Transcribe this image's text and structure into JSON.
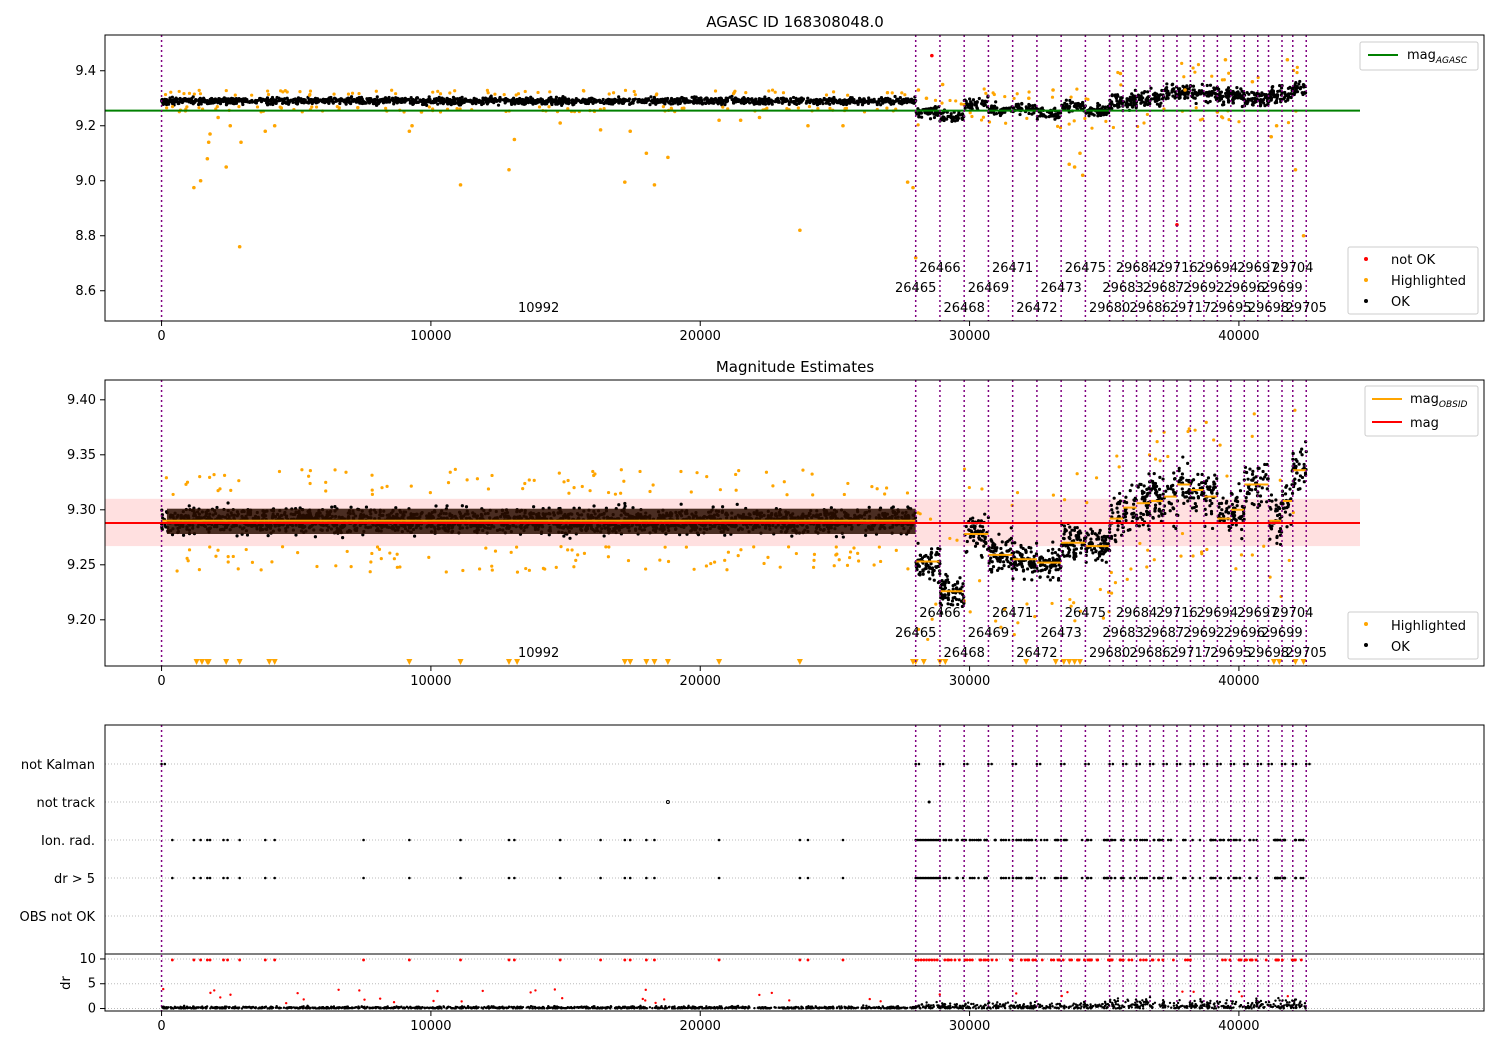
{
  "chart_data": [
    {
      "type": "scatter",
      "title": "AGASC ID 168308048.0",
      "xlim": [
        -2100,
        49100
      ],
      "ylim": [
        8.49,
        9.53
      ],
      "xticks": [
        0,
        10000,
        20000,
        30000,
        40000
      ],
      "yticks": [
        8.6,
        8.8,
        9.0,
        9.2,
        9.4
      ],
      "agasc_mag": 9.255,
      "legend_upper": [
        {
          "label": "mag",
          "sub": "AGASC",
          "color": "#008000",
          "kind": "line"
        }
      ],
      "legend_lower": [
        {
          "label": "not OK",
          "color": "#ff0000",
          "kind": "dot"
        },
        {
          "label": "Highlighted",
          "color": "#ffa500",
          "kind": "dot"
        },
        {
          "label": "OK",
          "color": "#000000",
          "kind": "dot"
        }
      ],
      "outliers": [
        [
          1200,
          8.975
        ],
        [
          1450,
          9.0
        ],
        [
          1700,
          9.08
        ],
        [
          1750,
          9.14
        ],
        [
          1800,
          9.17
        ],
        [
          2100,
          9.23
        ],
        [
          2400,
          9.05
        ],
        [
          2550,
          9.2
        ],
        [
          2900,
          8.76
        ],
        [
          2950,
          9.14
        ],
        [
          3850,
          9.18
        ],
        [
          4200,
          9.2
        ],
        [
          9200,
          9.18
        ],
        [
          9300,
          9.2
        ],
        [
          9650,
          9.25
        ],
        [
          11100,
          8.985
        ],
        [
          12900,
          9.04
        ],
        [
          13100,
          9.15
        ],
        [
          14800,
          9.21
        ],
        [
          16300,
          9.185
        ],
        [
          17200,
          8.995
        ],
        [
          17400,
          9.18
        ],
        [
          18000,
          9.1
        ],
        [
          18300,
          8.985
        ],
        [
          18800,
          9.085
        ],
        [
          20700,
          9.22
        ],
        [
          21500,
          9.22
        ],
        [
          22200,
          9.23
        ],
        [
          23700,
          8.82
        ],
        [
          24000,
          9.2
        ],
        [
          25300,
          9.2
        ],
        [
          27700,
          8.995
        ],
        [
          27900,
          8.975
        ],
        [
          28100,
          9.33
        ],
        [
          28400,
          9.3
        ],
        [
          29000,
          9.35
        ],
        [
          32200,
          9.3
        ],
        [
          33100,
          9.33
        ],
        [
          33700,
          9.06
        ],
        [
          33900,
          9.05
        ],
        [
          34100,
          9.1
        ],
        [
          34200,
          9.02
        ],
        [
          35600,
          9.39
        ],
        [
          38000,
          9.33
        ],
        [
          39200,
          9.25
        ],
        [
          39500,
          9.44
        ],
        [
          40500,
          9.36
        ],
        [
          41200,
          9.16
        ],
        [
          41400,
          9.2
        ],
        [
          41800,
          9.44
        ],
        [
          42100,
          9.04
        ],
        [
          42400,
          8.8
        ],
        [
          28000,
          8.72
        ]
      ],
      "not_ok": [
        [
          28600,
          9.455
        ],
        [
          37700,
          8.84
        ]
      ]
    },
    {
      "type": "scatter",
      "title": "Magnitude Estimates",
      "xlim": [
        -2100,
        49100
      ],
      "ylim": [
        9.158,
        9.418
      ],
      "xticks": [
        0,
        10000,
        20000,
        30000,
        40000
      ],
      "yticks": [
        9.2,
        9.25,
        9.3,
        9.35,
        9.4
      ],
      "mag": 9.288,
      "mag_band": [
        9.267,
        9.31
      ],
      "legend_upper": [
        {
          "label": "mag",
          "sub": "OBSID",
          "color": "#ffa500",
          "kind": "line"
        },
        {
          "label": "mag",
          "sub": "",
          "color": "#ff0000",
          "kind": "line"
        }
      ],
      "legend_lower": [
        {
          "label": "Highlighted",
          "color": "#ffa500",
          "kind": "dot"
        },
        {
          "label": "OK",
          "color": "#000000",
          "kind": "dot"
        }
      ],
      "obsid_mag": [
        [
          0,
          28000,
          9.29
        ],
        [
          28000,
          28900,
          9.253
        ],
        [
          28900,
          29800,
          9.226
        ],
        [
          29800,
          30700,
          9.278
        ],
        [
          30700,
          31600,
          9.259
        ],
        [
          31600,
          32500,
          9.255
        ],
        [
          32500,
          33400,
          9.252
        ],
        [
          33400,
          34300,
          9.27
        ],
        [
          34300,
          35200,
          9.267
        ],
        [
          35200,
          35700,
          9.292
        ],
        [
          35700,
          36200,
          9.302
        ],
        [
          36200,
          36700,
          9.306
        ],
        [
          36700,
          37200,
          9.308
        ],
        [
          37200,
          37700,
          9.312
        ],
        [
          37700,
          38200,
          9.323
        ],
        [
          38200,
          38700,
          9.318
        ],
        [
          38700,
          39200,
          9.312
        ],
        [
          39200,
          39700,
          9.292
        ],
        [
          39700,
          40200,
          9.3
        ],
        [
          40200,
          41100,
          9.323
        ],
        [
          41100,
          41600,
          9.29
        ],
        [
          41600,
          42000,
          9.308
        ],
        [
          42000,
          42500,
          9.336
        ]
      ]
    },
    {
      "type": "scatter",
      "title": "",
      "xlim": [
        -2100,
        49100
      ],
      "xticks": [
        0,
        10000,
        20000,
        30000,
        40000
      ],
      "flag_labels": [
        "not Kalman",
        "not track",
        "Ion. rad.",
        "dr > 5",
        "OBS not OK"
      ],
      "dr_ylabel": "dr",
      "dr_ylim": [
        -0.5,
        11
      ],
      "dr_yticks": [
        0,
        5,
        10
      ]
    }
  ],
  "obs_boundaries": [
    0,
    28000,
    28900,
    29800,
    30700,
    31600,
    32500,
    33400,
    34300,
    35200,
    35700,
    36200,
    36700,
    37200,
    37700,
    38200,
    38700,
    39200,
    39700,
    40200,
    40700,
    41100,
    41600,
    42000,
    42500
  ],
  "obsids": [
    {
      "label": "10992",
      "x": 14000,
      "row": 2
    },
    {
      "label": "26465",
      "x": 28000,
      "row": 1
    },
    {
      "label": "26466",
      "x": 28900,
      "row": 0
    },
    {
      "label": "26468",
      "x": 29800,
      "row": 2
    },
    {
      "label": "26469",
      "x": 30700,
      "row": 1
    },
    {
      "label": "26471",
      "x": 31600,
      "row": 0
    },
    {
      "label": "26472",
      "x": 32500,
      "row": 2
    },
    {
      "label": "26473",
      "x": 33400,
      "row": 1
    },
    {
      "label": "26475",
      "x": 34300,
      "row": 0
    },
    {
      "label": "29680",
      "x": 35200,
      "row": 2
    },
    {
      "label": "29683",
      "x": 35700,
      "row": 1
    },
    {
      "label": "29684",
      "x": 36200,
      "row": 0
    },
    {
      "label": "29686",
      "x": 36700,
      "row": 2
    },
    {
      "label": "29687",
      "x": 37200,
      "row": 1
    },
    {
      "label": "29716",
      "x": 37700,
      "row": 0
    },
    {
      "label": "29717",
      "x": 38200,
      "row": 2
    },
    {
      "label": "29692",
      "x": 38700,
      "row": 1
    },
    {
      "label": "29694",
      "x": 39200,
      "row": 0
    },
    {
      "label": "29695",
      "x": 39700,
      "row": 2
    },
    {
      "label": "29696",
      "x": 40200,
      "row": 1
    },
    {
      "label": "29697",
      "x": 40700,
      "row": 0
    },
    {
      "label": "29698",
      "x": 41100,
      "row": 2
    },
    {
      "label": "29699",
      "x": 41600,
      "row": 1
    },
    {
      "label": "29704",
      "x": 42000,
      "row": 0
    },
    {
      "label": "29705",
      "x": 42500,
      "row": 2
    }
  ]
}
